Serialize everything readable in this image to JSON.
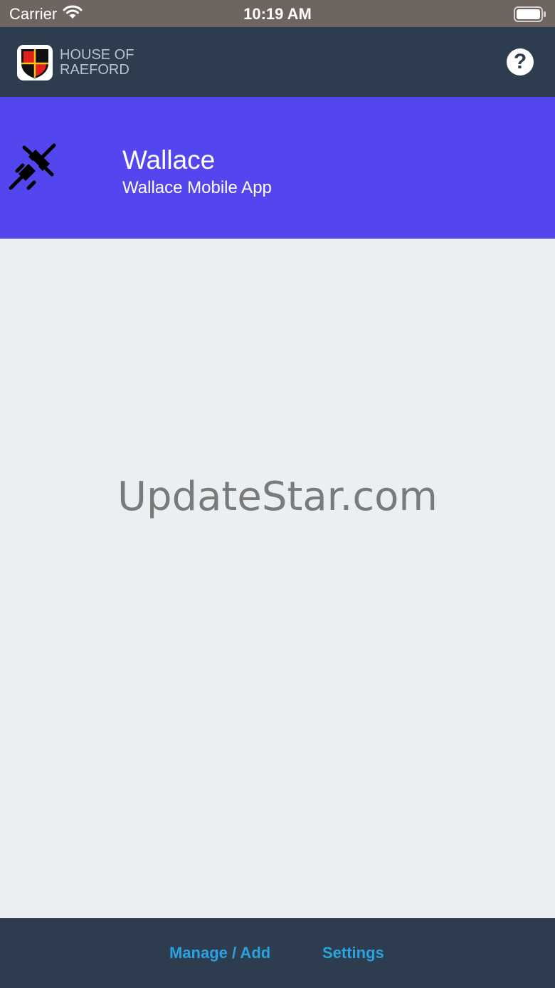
{
  "status_bar": {
    "carrier": "Carrier",
    "time": "10:19 AM",
    "wifi_icon": "wifi-icon",
    "battery_icon": "battery-icon"
  },
  "header": {
    "brand_line1": "HOUSE OF",
    "brand_line2": "RAEFORD",
    "logo_icon": "shield-logo-icon",
    "help_label": "?",
    "help_icon": "help-icon",
    "background_color": "#2E3C4F"
  },
  "banner": {
    "title": "Wallace",
    "subtitle": "Wallace Mobile App",
    "icon": "plug-icon",
    "background_color": "#5446EE"
  },
  "main": {
    "watermark": "UpdateStar.com"
  },
  "tab_bar": {
    "manage_label": "Manage / Add",
    "settings_label": "Settings",
    "accent_color": "#2AA2E0"
  }
}
